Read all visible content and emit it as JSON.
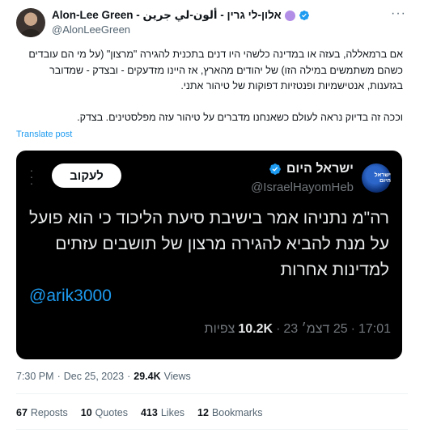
{
  "author": {
    "display_name": "Alon-Lee Green - אלון-לי גרין - ألون-لي جرين",
    "handle": "@AlonLeeGreen",
    "verified_color": "#1d9bf0",
    "badge_color": "#b38ee6"
  },
  "post": {
    "paragraph1": "אם ברמאללה, בעזה או במדינה כלשהי היו דנים בתכנית להגירה \"מרצון\" (על מי הם עובדים כשהם משתמשים במילה הזו) של יהודים מהארץ, אז היינו מזדעקים - ובצדק - שמדובר בגזענות, אנטישמיות ופנטזיות דפוקות של טיהור אתני.",
    "paragraph2": "וככה זה בדיוק נראה לעולם כשאנחנו מדברים על טיהור עזה מפלסטינים. בצדק.",
    "translate_label": "Translate post"
  },
  "quote": {
    "logo_text": "ישראל היום",
    "name": "ישראל היום",
    "handle": "@IsraelHayomHeb",
    "follow_label": "לעקוב",
    "body": "רה\"מ נתניהו אמר בישיבת סיעת הליכוד כי הוא פועל על מנת להביא להגירה מרצון של תושבים עזתים למדינות אחרות",
    "mention": "@arik3000",
    "time": "17:01",
    "date": "25 דצמ׳ 23",
    "views_count": "10.2K",
    "views_label": "צפיות",
    "sep": "·"
  },
  "meta": {
    "time": "7:30 PM",
    "sep": "·",
    "date": "Dec 25, 2023",
    "views_count": "29.4K",
    "views_label": "Views"
  },
  "stats": {
    "reposts_count": "67",
    "reposts_label": "Reposts",
    "quotes_count": "10",
    "quotes_label": "Quotes",
    "likes_count": "413",
    "likes_label": "Likes",
    "bookmarks_count": "12",
    "bookmarks_label": "Bookmarks"
  },
  "icons": {
    "more": "more-horizontal-icon",
    "verified": "verified-badge-icon"
  }
}
